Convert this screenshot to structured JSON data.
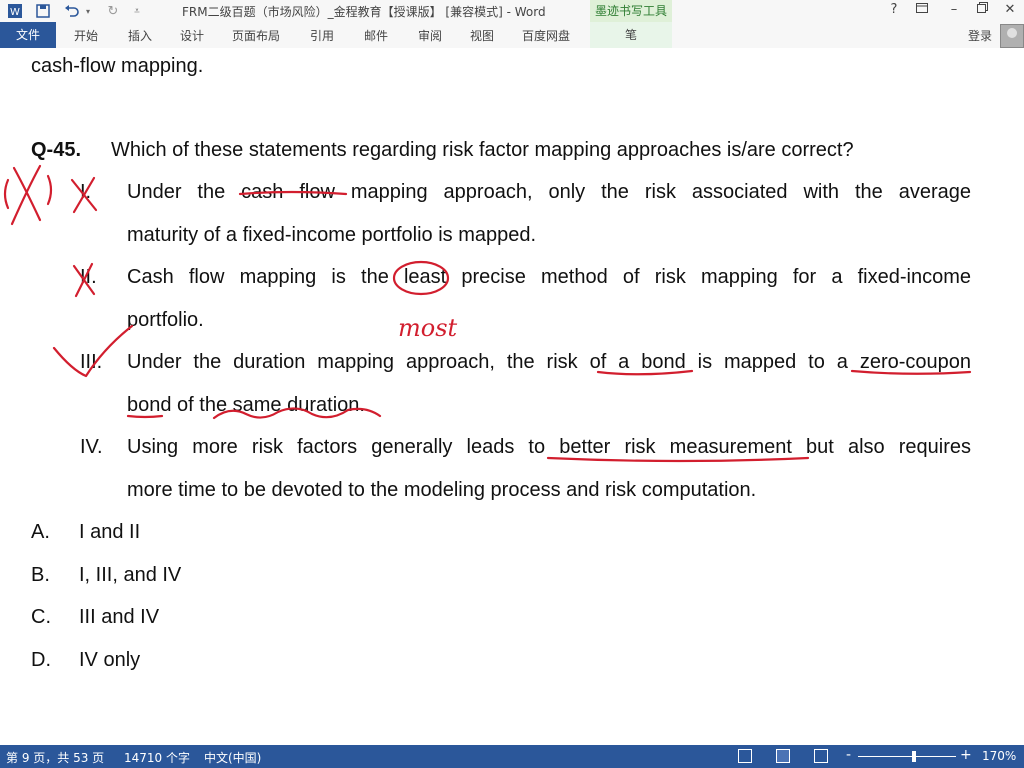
{
  "titlebar": {
    "word_icon": "word-app-icon",
    "quick_access": [
      "save-icon",
      "undo-icon",
      "redo-icon",
      "customize-icon"
    ],
    "document_title": "FRM二级百题（市场风险）_金程教育【授课版】 [兼容模式] - Word",
    "context_tab_title": "墨迹书写工具",
    "help": "?",
    "window_controls": [
      "ribbon-display-icon",
      "minimize-icon",
      "restore-icon",
      "close-icon"
    ]
  },
  "ribbon": {
    "file_tab": "文件",
    "tabs": [
      "开始",
      "插入",
      "设计",
      "页面布局",
      "引用",
      "邮件",
      "审阅",
      "视图",
      "百度网盘"
    ],
    "context_tab": "笔",
    "login": "登录"
  },
  "document": {
    "prev_tail": "cash-flow mapping.",
    "question_number": "Q-45.",
    "question_text": "Which of these statements regarding risk factor mapping approaches is/are correct?",
    "statements": [
      {
        "num": "I.",
        "line1": "Under the cash flow mapping approach, only the risk associated with the average",
        "line2": "maturity of a fixed-income portfolio is mapped."
      },
      {
        "num": "II.",
        "line1": "Cash flow mapping is the least precise method of risk mapping for a fixed-income",
        "line2": "portfolio."
      },
      {
        "num": "III.",
        "line1": "Under the duration mapping approach, the risk of a bond is mapped to a zero-coupon",
        "line2": "bond of the same duration."
      },
      {
        "num": "IV.",
        "line1": "Using more risk factors generally leads to better risk measurement but also requires",
        "line2": "more time to be devoted to the modeling process and risk computation."
      }
    ],
    "options": [
      {
        "letter": "A.",
        "text": "I and II"
      },
      {
        "letter": "B.",
        "text": "I, III, and IV"
      },
      {
        "letter": "C.",
        "text": "III and IV"
      },
      {
        "letter": "D.",
        "text": "IV only"
      }
    ],
    "handwriting": {
      "annotation_text": "most",
      "ink_color": "#d21e2e"
    }
  },
  "statusbar": {
    "page": "第 9 页，共 53 页",
    "words": "14710 个字",
    "language": "中文(中国)",
    "view_icons": [
      "read-mode-icon",
      "print-layout-icon",
      "web-layout-icon"
    ],
    "zoom_out": "-",
    "zoom_in": "+",
    "zoom": "170%"
  }
}
